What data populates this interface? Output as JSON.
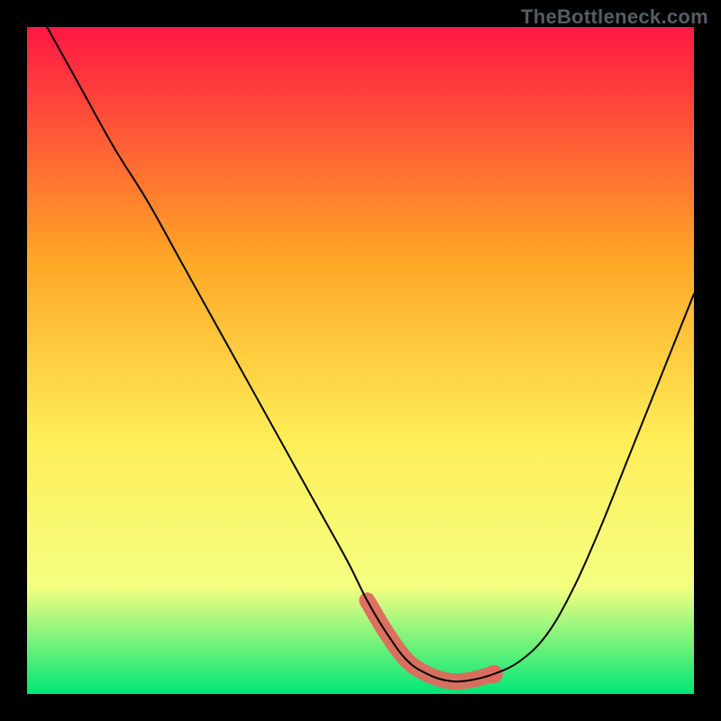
{
  "watermark": "TheBottleneck.com",
  "colors": {
    "gradient_top": "#ff1744",
    "gradient_mid1": "#ffa726",
    "gradient_mid2": "#ffee58",
    "gradient_mid3": "#f4ff81",
    "gradient_bottom": "#00e676",
    "curve": "#000000",
    "highlight": "#e0685e",
    "frame": "#000000"
  },
  "chart_data": {
    "type": "line",
    "title": "",
    "xlabel": "",
    "ylabel": "",
    "xlim": [
      0,
      100
    ],
    "ylim": [
      0,
      100
    ],
    "x": [
      3,
      8,
      13,
      18,
      23,
      28,
      33,
      38,
      43,
      48,
      51,
      54,
      57,
      60,
      63,
      66,
      70,
      74,
      78,
      82,
      86,
      90,
      94,
      98,
      100
    ],
    "values": [
      100,
      91,
      82,
      74,
      65,
      56,
      47,
      38,
      29,
      20,
      14,
      9,
      5,
      3,
      2,
      2,
      3,
      5,
      9,
      16,
      25,
      35,
      45,
      55,
      60
    ],
    "highlight_region": {
      "x": [
        51,
        54,
        57,
        60,
        63,
        66,
        70
      ],
      "values": [
        14,
        9,
        5,
        3,
        2,
        2,
        3
      ],
      "end_dot": {
        "x": 70,
        "y": 3
      }
    },
    "note": "Values are relative percent height where 0 is bottom of inner plot and 100 is top; x is percent across inner plot width."
  },
  "layout": {
    "inner_x": 30,
    "inner_y": 30,
    "inner_w": 740,
    "inner_h": 740
  }
}
